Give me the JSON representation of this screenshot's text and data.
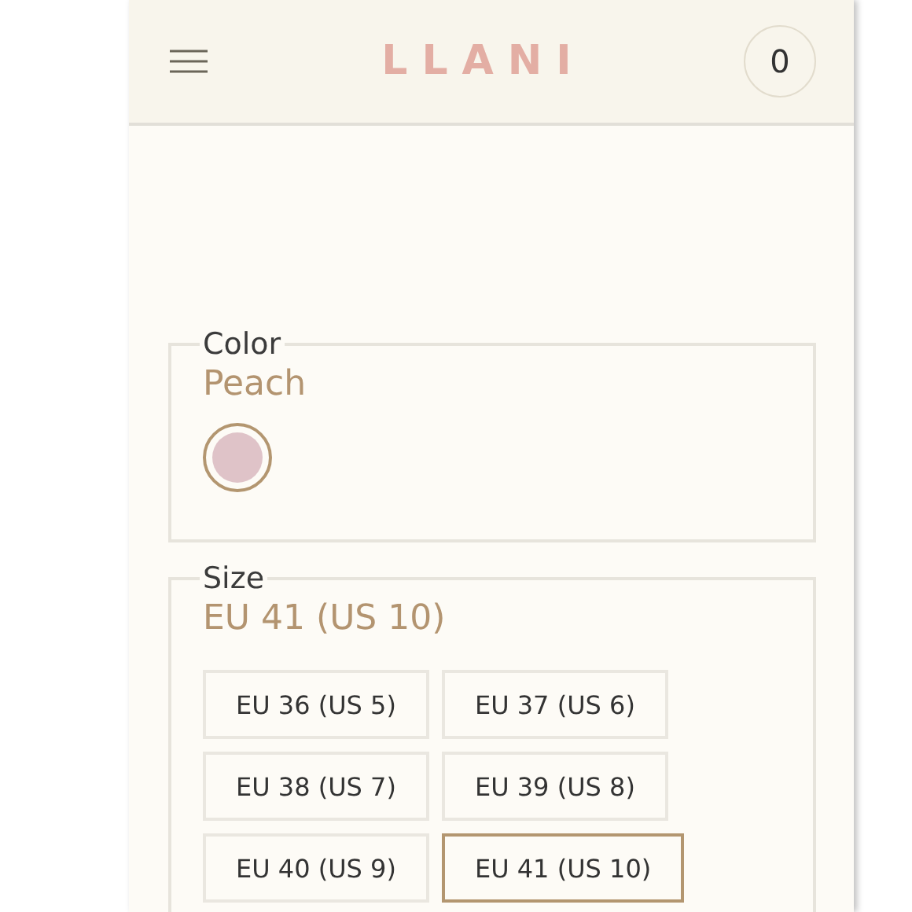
{
  "header": {
    "logo": "LLANI",
    "cart_count": "0"
  },
  "color": {
    "legend": "Color",
    "value": "Peach",
    "swatches": [
      {
        "color": "#dfc3c8",
        "selected": true
      }
    ]
  },
  "size": {
    "legend": "Size",
    "value": "EU 41 (US 10)",
    "options": [
      {
        "label": "EU 36 (US 5)",
        "selected": false
      },
      {
        "label": "EU 37 (US 6)",
        "selected": false
      },
      {
        "label": "EU 38 (US 7)",
        "selected": false
      },
      {
        "label": "EU 39 (US 8)",
        "selected": false
      },
      {
        "label": "EU 40 (US 9)",
        "selected": false
      },
      {
        "label": "EU 41 (US 10)",
        "selected": true
      }
    ]
  }
}
